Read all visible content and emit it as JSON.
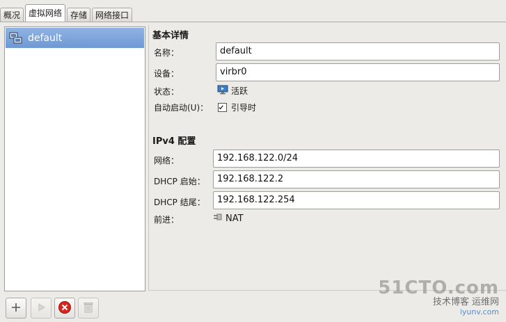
{
  "tabs": [
    "概况",
    "虚拟网络",
    "存储",
    "网络接口"
  ],
  "active_tab": 1,
  "network_list": [
    {
      "name": "default",
      "icon": "network-computer-icon"
    }
  ],
  "bottom_buttons": {
    "add": {
      "icon": "plus-icon"
    },
    "start": {
      "icon": "play-icon"
    },
    "stop": {
      "icon": "stop-red-x-icon"
    },
    "delete": {
      "icon": "trash-icon"
    }
  },
  "basic_details": {
    "heading": "基本详情",
    "name_label": "名称：",
    "name_value": "default",
    "device_label": "设备：",
    "device_value": "virbr0",
    "state_label": "状态：",
    "state_value": "活跃",
    "autostart_label": "自动启动(U)：",
    "autostart_value": "引导时",
    "autostart_checked": true
  },
  "ipv4": {
    "heading": "IPv4 配置",
    "network_label": "网络：",
    "network_value": "192.168.122.0/24",
    "dhcp_start_label": "DHCP 启始：",
    "dhcp_start_value": "192.168.122.2",
    "dhcp_end_label": "DHCP 结尾：",
    "dhcp_end_value": "192.168.122.254",
    "forward_label": "前进：",
    "forward_value": "NAT"
  },
  "watermark": {
    "line1": "51CTO.com",
    "line2": "技术博客 运维网",
    "line3": "iyunv.com"
  }
}
